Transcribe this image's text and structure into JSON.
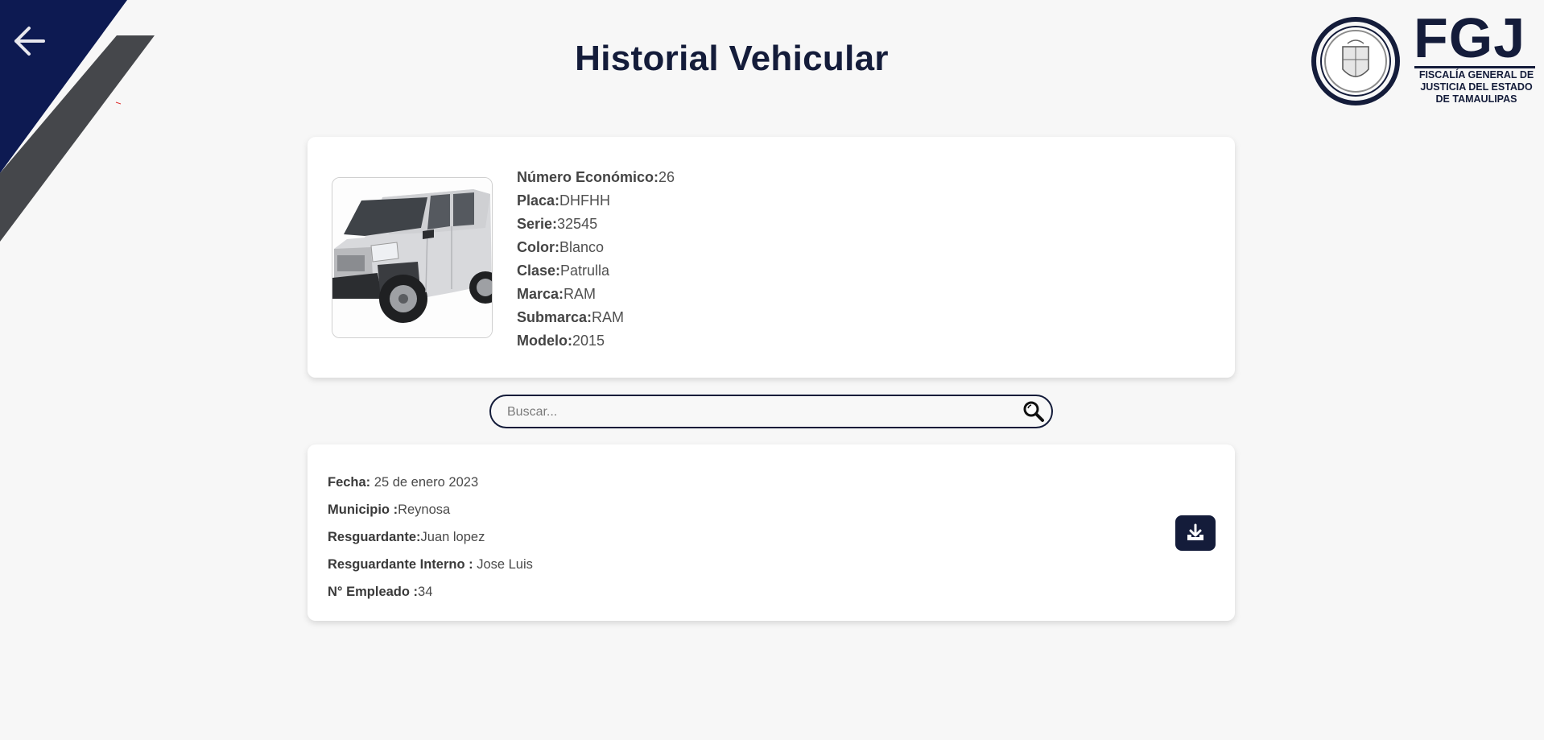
{
  "header": {
    "title": "Historial Vehicular",
    "back_icon": "arrow-left-icon",
    "logo": {
      "wordmark": "FGJ",
      "subtitle_lines": [
        "FISCALÍA GENERAL DE",
        "JUSTICIA DEL ESTADO",
        "DE TAMAULIPAS"
      ]
    }
  },
  "vehicle": {
    "photo_icon": "pickup-truck-image",
    "fields": [
      {
        "label": "Número Económico:",
        "value": "26"
      },
      {
        "label": "Placa:",
        "value": "DHFHH"
      },
      {
        "label": "Serie:",
        "value": "32545"
      },
      {
        "label": "Color:",
        "value": "Blanco"
      },
      {
        "label": "Clase:",
        "value": "Patrulla"
      },
      {
        "label": "Marca:",
        "value": "RAM"
      },
      {
        "label": "Submarca:",
        "value": "RAM"
      },
      {
        "label": "Modelo:",
        "value": "2015"
      }
    ]
  },
  "search": {
    "placeholder": "Buscar...",
    "value": "",
    "icon": "search-icon"
  },
  "history": {
    "records": [
      {
        "fields": [
          {
            "label": "Fecha:",
            "value": " 25 de enero 2023"
          },
          {
            "label": "Municipio :",
            "value": "Reynosa"
          },
          {
            "label": "Resguardante:",
            "value": "Juan lopez"
          },
          {
            "label": "Resguardante Interno :",
            "value": " Jose Luis"
          },
          {
            "label": "N° Empleado :",
            "value": "34"
          }
        ],
        "action_icon": "download-icon"
      }
    ]
  },
  "colors": {
    "navy": "#141c3a",
    "corner_navy": "#0d1a52",
    "corner_gray": "#45474b",
    "background": "#f7f7f7",
    "card": "#ffffff"
  }
}
